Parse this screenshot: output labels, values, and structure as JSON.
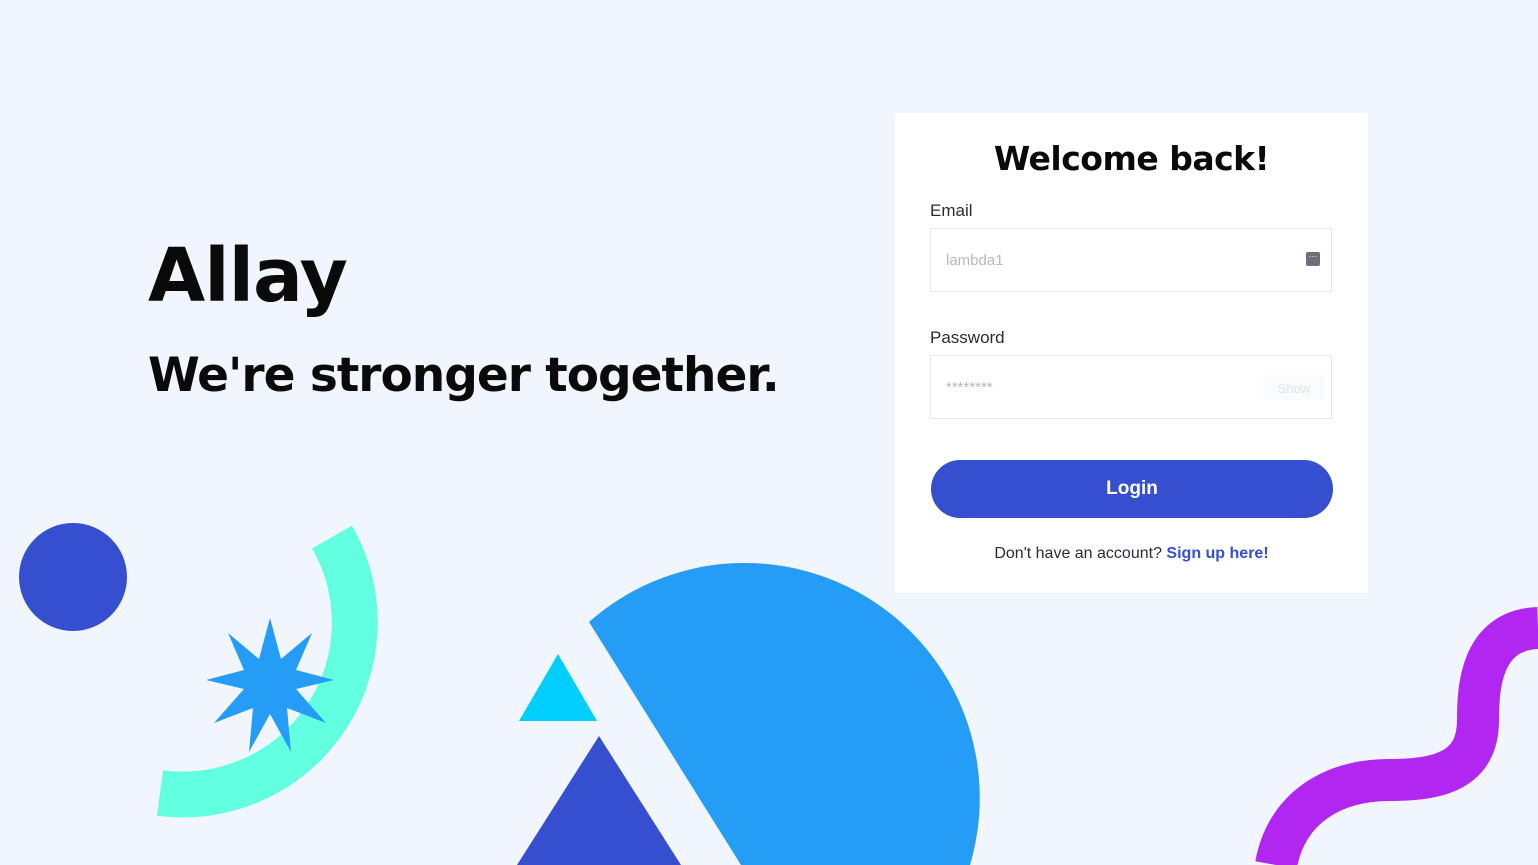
{
  "hero": {
    "brand": "Allay",
    "tagline": "We're stronger together."
  },
  "login_card": {
    "title": "Welcome back!",
    "email_label": "Email",
    "email_placeholder": "lambda1",
    "password_label": "Password",
    "password_placeholder": "********",
    "show_label": "Show",
    "login_label": "Login",
    "signup_prompt": "Don't have an account?",
    "signup_link": "Sign up here!"
  },
  "colors": {
    "background": "#f1f6fe",
    "primary": "#364fd0",
    "sky_blue": "#259cf5",
    "mint": "#62ffe0",
    "cyan": "#00cffe",
    "purple": "#b226f2"
  },
  "decorations": [
    "circle",
    "mint-arc",
    "star-icon",
    "cyan-triangle",
    "navy-triangle",
    "blue-half-circle",
    "purple-wave"
  ]
}
